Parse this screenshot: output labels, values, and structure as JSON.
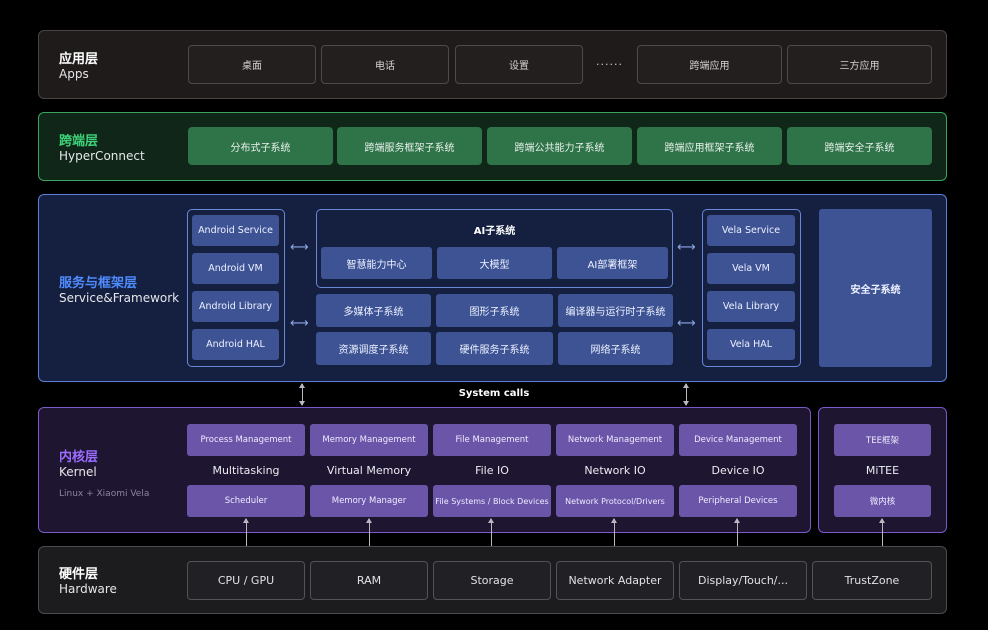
{
  "apps": {
    "title": "应用层",
    "subtitle": "Apps",
    "items": [
      "桌面",
      "电话",
      "设置",
      "跨端应用",
      "三方应用"
    ],
    "ellipsis": "······"
  },
  "hyper": {
    "title": "跨端层",
    "subtitle": "HyperConnect",
    "items": [
      "分布式子系统",
      "跨端服务框架子系统",
      "跨端公共能力子系统",
      "跨端应用框架子系统",
      "跨端安全子系统"
    ]
  },
  "service": {
    "title": "服务与框架层",
    "subtitle": "Service&Framework",
    "android": [
      "Android Service",
      "Android VM",
      "Android Library",
      "Android HAL"
    ],
    "ai": {
      "title": "AI子系统",
      "items": [
        "智慧能力中心",
        "大模型",
        "AI部署框架"
      ]
    },
    "middle": [
      "多媒体子系统",
      "图形子系统",
      "编译器与运行时子系统",
      "资源调度子系统",
      "硬件服务子系统",
      "网络子系统"
    ],
    "vela": [
      "Vela Service",
      "Vela VM",
      "Vela Library",
      "Vela HAL"
    ],
    "security": "安全子系统",
    "arrow": "⟷"
  },
  "syscalls": "System calls",
  "kernel": {
    "title": "内核层",
    "subtitle": "Kernel",
    "note": "Linux + Xiaomi Vela",
    "top": [
      "Process Management",
      "Memory Management",
      "File Management",
      "Network Management",
      "Device Management"
    ],
    "labels": [
      "Multitasking",
      "Virtual Memory",
      "File IO",
      "Network IO",
      "Device IO"
    ],
    "bottom": [
      "Scheduler",
      "Memory Manager",
      "File Systems / Block Devices",
      "Network Protocol/Drivers",
      "Peripheral Devices"
    ]
  },
  "mitee": {
    "top": "TEE框架",
    "label": "MiTEE",
    "bottom": "微内核"
  },
  "hardware": {
    "title": "硬件层",
    "subtitle": "Hardware",
    "items": [
      "CPU / GPU",
      "RAM",
      "Storage",
      "Network Adapter",
      "Display/Touch/...",
      "TrustZone"
    ]
  }
}
